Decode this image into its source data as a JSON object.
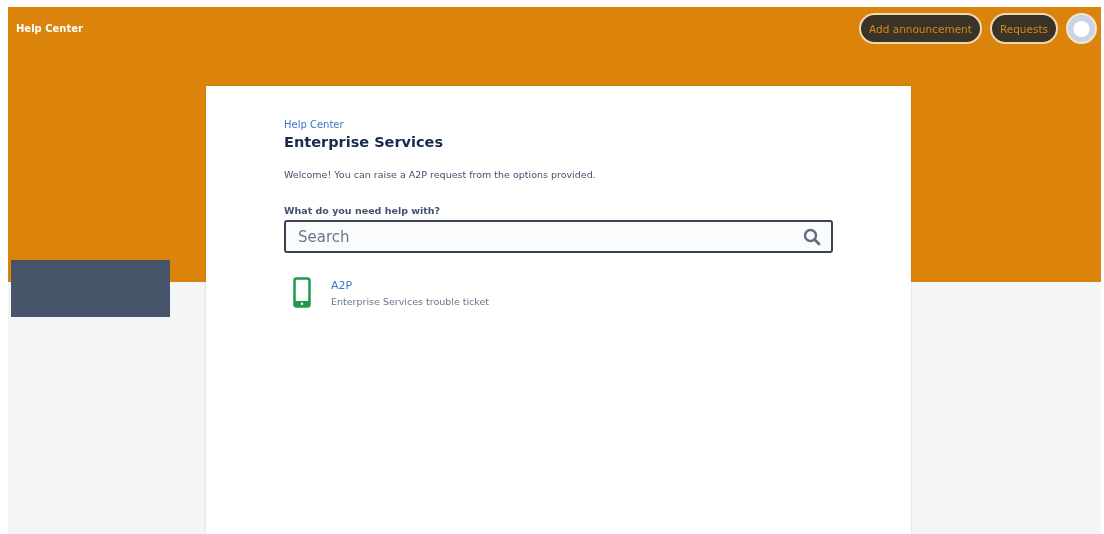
{
  "header": {
    "title": "Help Center",
    "buttons": [
      "Add announcement",
      "Requests"
    ]
  },
  "portal": {
    "breadcrumb": "Help Center",
    "title": "Enterprise Services",
    "welcome": "Welcome! You can raise a A2P request from the options provided.",
    "search": {
      "label": "What do you need help with?",
      "placeholder": "Search"
    },
    "request_types": [
      {
        "name": "A2P",
        "description": "Enterprise Services trouble ticket"
      }
    ]
  }
}
